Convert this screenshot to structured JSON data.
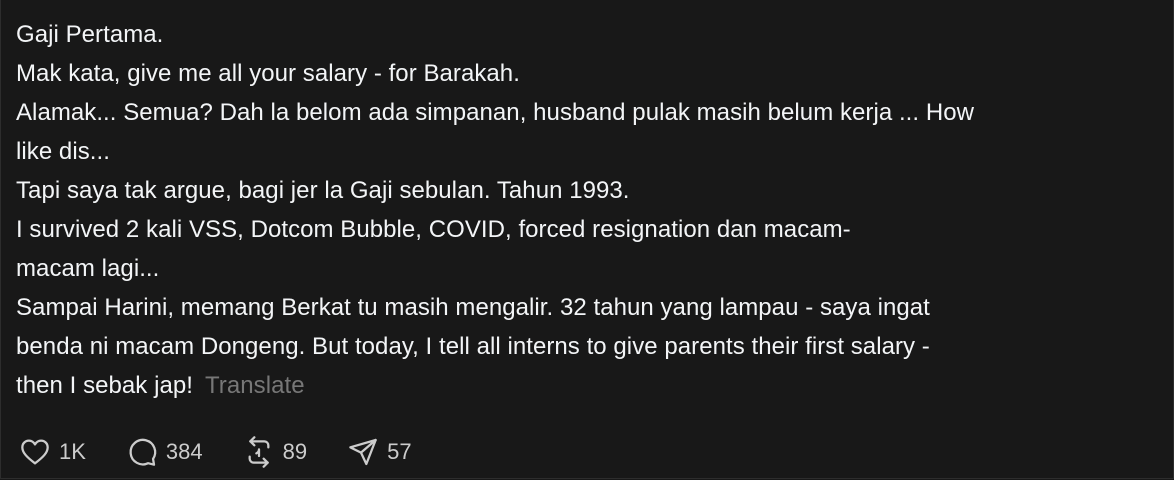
{
  "post": {
    "lines": [
      "Gaji Pertama.",
      "Mak kata, give me all your salary - for Barakah.",
      "Alamak... Semua? Dah la belom ada simpanan, husband pulak masih belum kerja ... How",
      "like dis...",
      "Tapi saya tak argue, bagi jer la Gaji sebulan. Tahun 1993.",
      "I survived 2 kali VSS, Dotcom Bubble, COVID, forced resignation dan macam-",
      "macam lagi...",
      "Sampai Harini, memang Berkat tu masih mengalir. 32 tahun yang lampau - saya ingat",
      "benda ni macam Dongeng. But today, I tell all interns to give parents their first salary -",
      "then I sebak jap!"
    ],
    "translate_label": "Translate"
  },
  "actions": {
    "likes": "1K",
    "replies": "384",
    "reposts": "89",
    "shares": "57",
    "icons": [
      "heart-icon",
      "comment-icon",
      "repost-icon",
      "share-icon"
    ]
  },
  "colors": {
    "background": "#181818",
    "text": "#f3f5f7",
    "muted": "#777777"
  }
}
